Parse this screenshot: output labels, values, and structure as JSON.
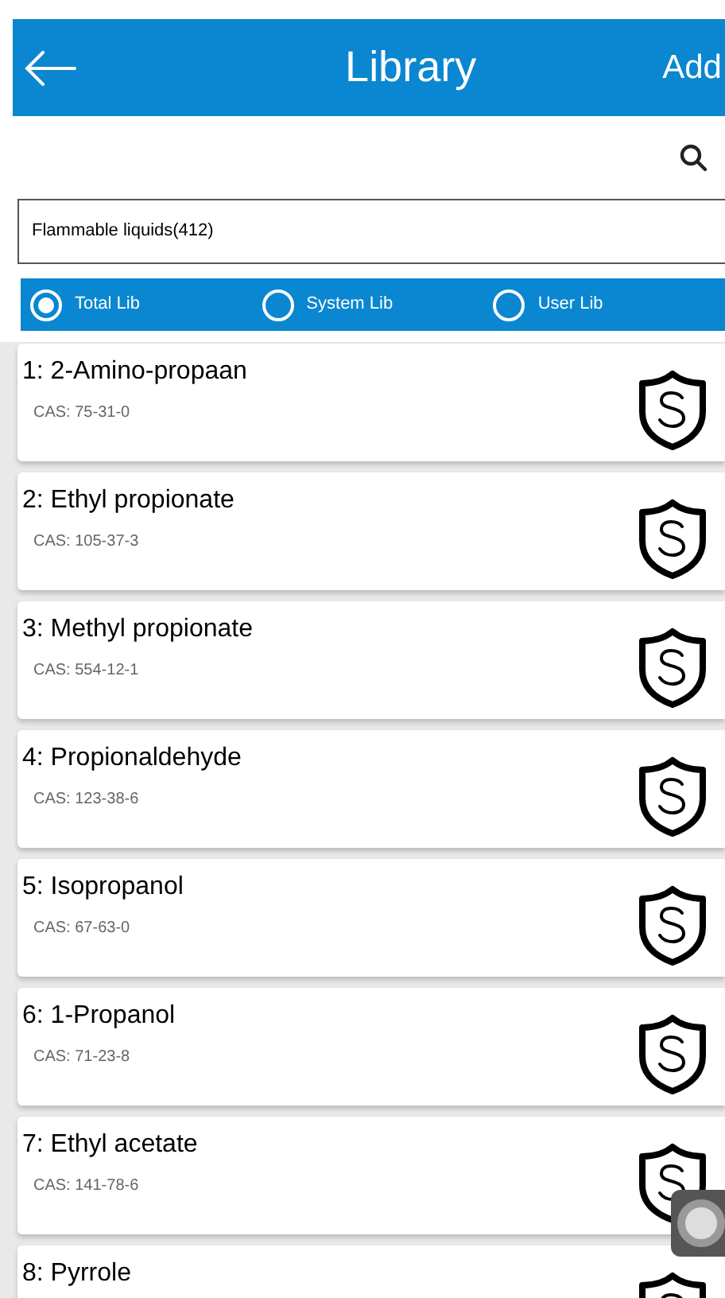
{
  "header": {
    "title": "Library",
    "action": "Add"
  },
  "filter": {
    "value": "Flammable liquids(412)"
  },
  "lib_options": [
    {
      "label": "Total Lib",
      "selected": true
    },
    {
      "label": "System Lib",
      "selected": false
    },
    {
      "label": "User Lib",
      "selected": false
    }
  ],
  "items": [
    {
      "name": "1: 2-Amino-propaan",
      "cas": "CAS: 75-31-0"
    },
    {
      "name": "2: Ethyl propionate",
      "cas": "CAS: 105-37-3"
    },
    {
      "name": "3: Methyl propionate",
      "cas": "CAS: 554-12-1"
    },
    {
      "name": "4: Propionaldehyde",
      "cas": "CAS: 123-38-6"
    },
    {
      "name": "5: Isopropanol",
      "cas": "CAS: 67-63-0"
    },
    {
      "name": "6: 1-Propanol",
      "cas": "CAS: 71-23-8"
    },
    {
      "name": "7: Ethyl acetate",
      "cas": "CAS: 141-78-6"
    },
    {
      "name": "8: Pyrrole"
    }
  ]
}
